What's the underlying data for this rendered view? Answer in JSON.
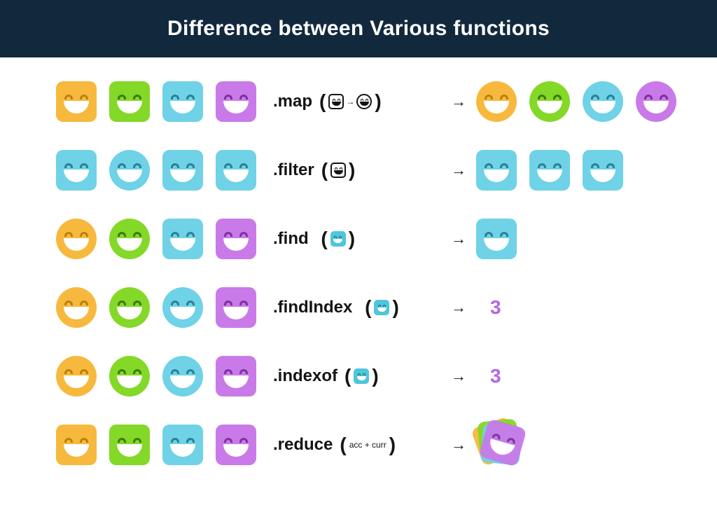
{
  "title": "Difference between Various functions",
  "colors": {
    "orange": "#f7b93d",
    "green": "#84d827",
    "blue": "#6fd2e6",
    "purple": "#c97ae8",
    "accent": "#b266e5",
    "header": "#12293d"
  },
  "arrow_glyph": "→",
  "rows": [
    {
      "fn": ".map",
      "arg_type": "transform",
      "arg_text": "→",
      "inputs": [
        {
          "shape": "square",
          "color": "orange"
        },
        {
          "shape": "square",
          "color": "green"
        },
        {
          "shape": "square",
          "color": "blue"
        },
        {
          "shape": "square",
          "color": "purple"
        }
      ],
      "outputs": [
        {
          "shape": "circle",
          "color": "orange"
        },
        {
          "shape": "circle",
          "color": "green"
        },
        {
          "shape": "circle",
          "color": "blue"
        },
        {
          "shape": "circle",
          "color": "purple"
        }
      ]
    },
    {
      "fn": ".filter",
      "arg_type": "predicate-outline",
      "inputs": [
        {
          "shape": "square",
          "color": "blue"
        },
        {
          "shape": "circle",
          "color": "blue"
        },
        {
          "shape": "square",
          "color": "blue"
        },
        {
          "shape": "square",
          "color": "blue"
        }
      ],
      "outputs": [
        {
          "shape": "square",
          "color": "blue"
        },
        {
          "shape": "square",
          "color": "blue"
        },
        {
          "shape": "square",
          "color": "blue"
        }
      ]
    },
    {
      "fn": ".find",
      "arg_type": "predicate-blue",
      "inputs": [
        {
          "shape": "circle",
          "color": "orange"
        },
        {
          "shape": "circle",
          "color": "green"
        },
        {
          "shape": "square",
          "color": "blue"
        },
        {
          "shape": "square",
          "color": "purple"
        }
      ],
      "outputs": [
        {
          "shape": "square",
          "color": "blue"
        }
      ]
    },
    {
      "fn": ".findIndex",
      "arg_type": "predicate-blue",
      "inputs": [
        {
          "shape": "circle",
          "color": "orange"
        },
        {
          "shape": "circle",
          "color": "green"
        },
        {
          "shape": "circle",
          "color": "blue"
        },
        {
          "shape": "square",
          "color": "purple"
        }
      ],
      "result": "3"
    },
    {
      "fn": ".indexof",
      "arg_type": "predicate-blue",
      "inputs": [
        {
          "shape": "circle",
          "color": "orange"
        },
        {
          "shape": "circle",
          "color": "green"
        },
        {
          "shape": "circle",
          "color": "blue"
        },
        {
          "shape": "square",
          "color": "purple"
        }
      ],
      "result": "3"
    },
    {
      "fn": ".reduce",
      "arg_type": "text",
      "arg_text": "acc + curr",
      "inputs": [
        {
          "shape": "square",
          "color": "orange"
        },
        {
          "shape": "square",
          "color": "green"
        },
        {
          "shape": "square",
          "color": "blue"
        },
        {
          "shape": "square",
          "color": "purple"
        }
      ],
      "stack_output": true
    }
  ]
}
